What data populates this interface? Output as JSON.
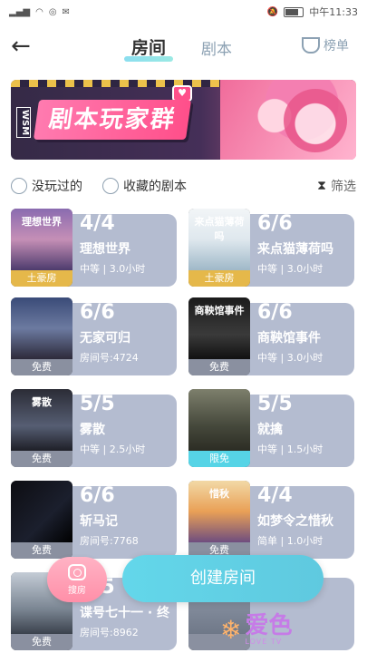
{
  "status": {
    "time": "中午11:33"
  },
  "header": {
    "tab_active": "房间",
    "tab_inactive": "剧本",
    "rank_label": "榜单"
  },
  "banner": {
    "title": "剧本玩家群",
    "side_text": "WSM",
    "heart": "♥"
  },
  "filters": {
    "not_played": "没玩过的",
    "favorited": "收藏的剧本",
    "screen": "筛选"
  },
  "rooms": [
    {
      "title": "理想世界",
      "art_text": "理想世界",
      "count": "4/4",
      "meta": "中等 | 3.0小时",
      "tag": "土豪房",
      "tag_style": "gold",
      "art": "art-ideal"
    },
    {
      "title": "来点猫薄荷吗",
      "art_text": "来点猫薄荷吗",
      "count": "6/6",
      "meta": "中等 | 3.0小时",
      "tag": "土豪房",
      "tag_style": "gold",
      "art": "art-cat"
    },
    {
      "title": "无家可归",
      "art_text": "",
      "count": "6/6",
      "meta": "房间号:4724",
      "tag": "免费",
      "tag_style": "gray",
      "art": "art-home"
    },
    {
      "title": "商鞅馆事件",
      "art_text": "商鞅馆事件",
      "count": "6/6",
      "meta": "中等 | 3.0小时",
      "tag": "免费",
      "tag_style": "gray",
      "art": "art-house"
    },
    {
      "title": "雾散",
      "art_text": "雾散",
      "count": "5/5",
      "meta": "中等 | 2.5小时",
      "tag": "免费",
      "tag_style": "gray",
      "art": "art-fog"
    },
    {
      "title": "就擒",
      "art_text": "",
      "count": "5/5",
      "meta": "中等 | 1.5小时",
      "tag": "限免",
      "tag_style": "cyan",
      "art": "art-capture"
    },
    {
      "title": "斩马记",
      "art_text": "",
      "count": "6/6",
      "meta": "房间号:7768",
      "tag": "免费",
      "tag_style": "gray",
      "art": "art-sword"
    },
    {
      "title": "如梦令之惜秋",
      "art_text": "惜秋",
      "count": "4/4",
      "meta": "简单 | 1.0小时",
      "tag": "免费",
      "tag_style": "gray",
      "art": "art-dream"
    },
    {
      "title": "谍号七十一 · 终",
      "art_text": "",
      "count": "5/5",
      "meta": "房间号:8962",
      "tag": "免费",
      "tag_style": "gray",
      "art": "art-spy"
    },
    {
      "title": "",
      "art_text": "",
      "count": "",
      "meta": "",
      "tag": "",
      "tag_style": "gray",
      "art": "art-extra"
    }
  ],
  "bottom": {
    "search_label": "搜房",
    "create_label": "创建房间"
  },
  "watermark": {
    "text": "爱色",
    "sub": "LOVE TV"
  }
}
